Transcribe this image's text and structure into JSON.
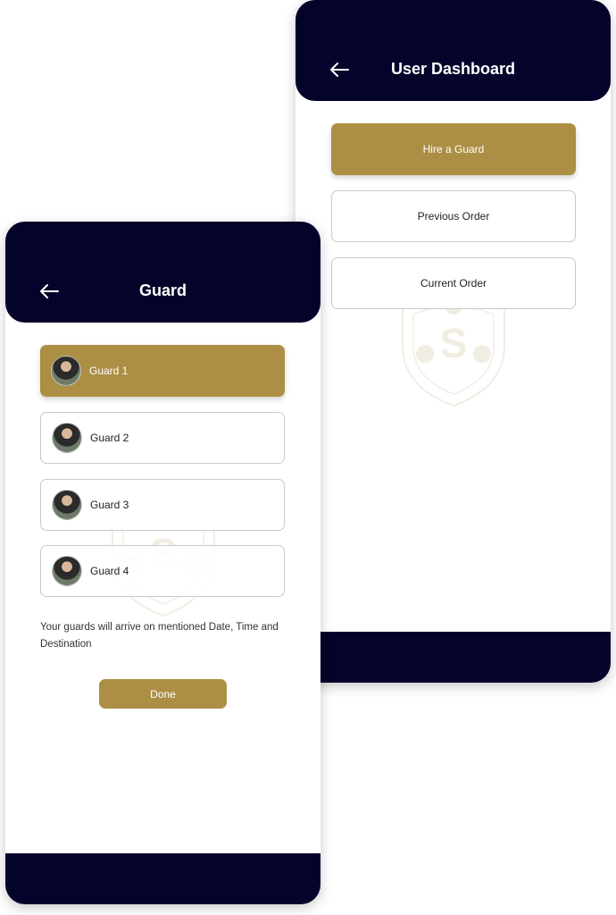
{
  "dashboard": {
    "title": "User Dashboard",
    "buttons": {
      "hire": "Hire a Guard",
      "previous": "Previous Order",
      "current": "Current Order"
    }
  },
  "guard_screen": {
    "title": "Guard",
    "guards": [
      {
        "label": "Guard 1",
        "selected": true
      },
      {
        "label": "Guard 2",
        "selected": false
      },
      {
        "label": "Guard 3",
        "selected": false
      },
      {
        "label": "Guard 4",
        "selected": false
      }
    ],
    "info": "Your guards will arrive on mentioned Date, Time and Destination",
    "done_label": "Done"
  },
  "icons": {
    "back": "arrow-left-icon",
    "watermark": "shield-logo-icon",
    "avatar": "guard-avatar"
  },
  "colors": {
    "navy": "#04032a",
    "gold": "#ac8f45",
    "border": "#c9c9c9"
  }
}
